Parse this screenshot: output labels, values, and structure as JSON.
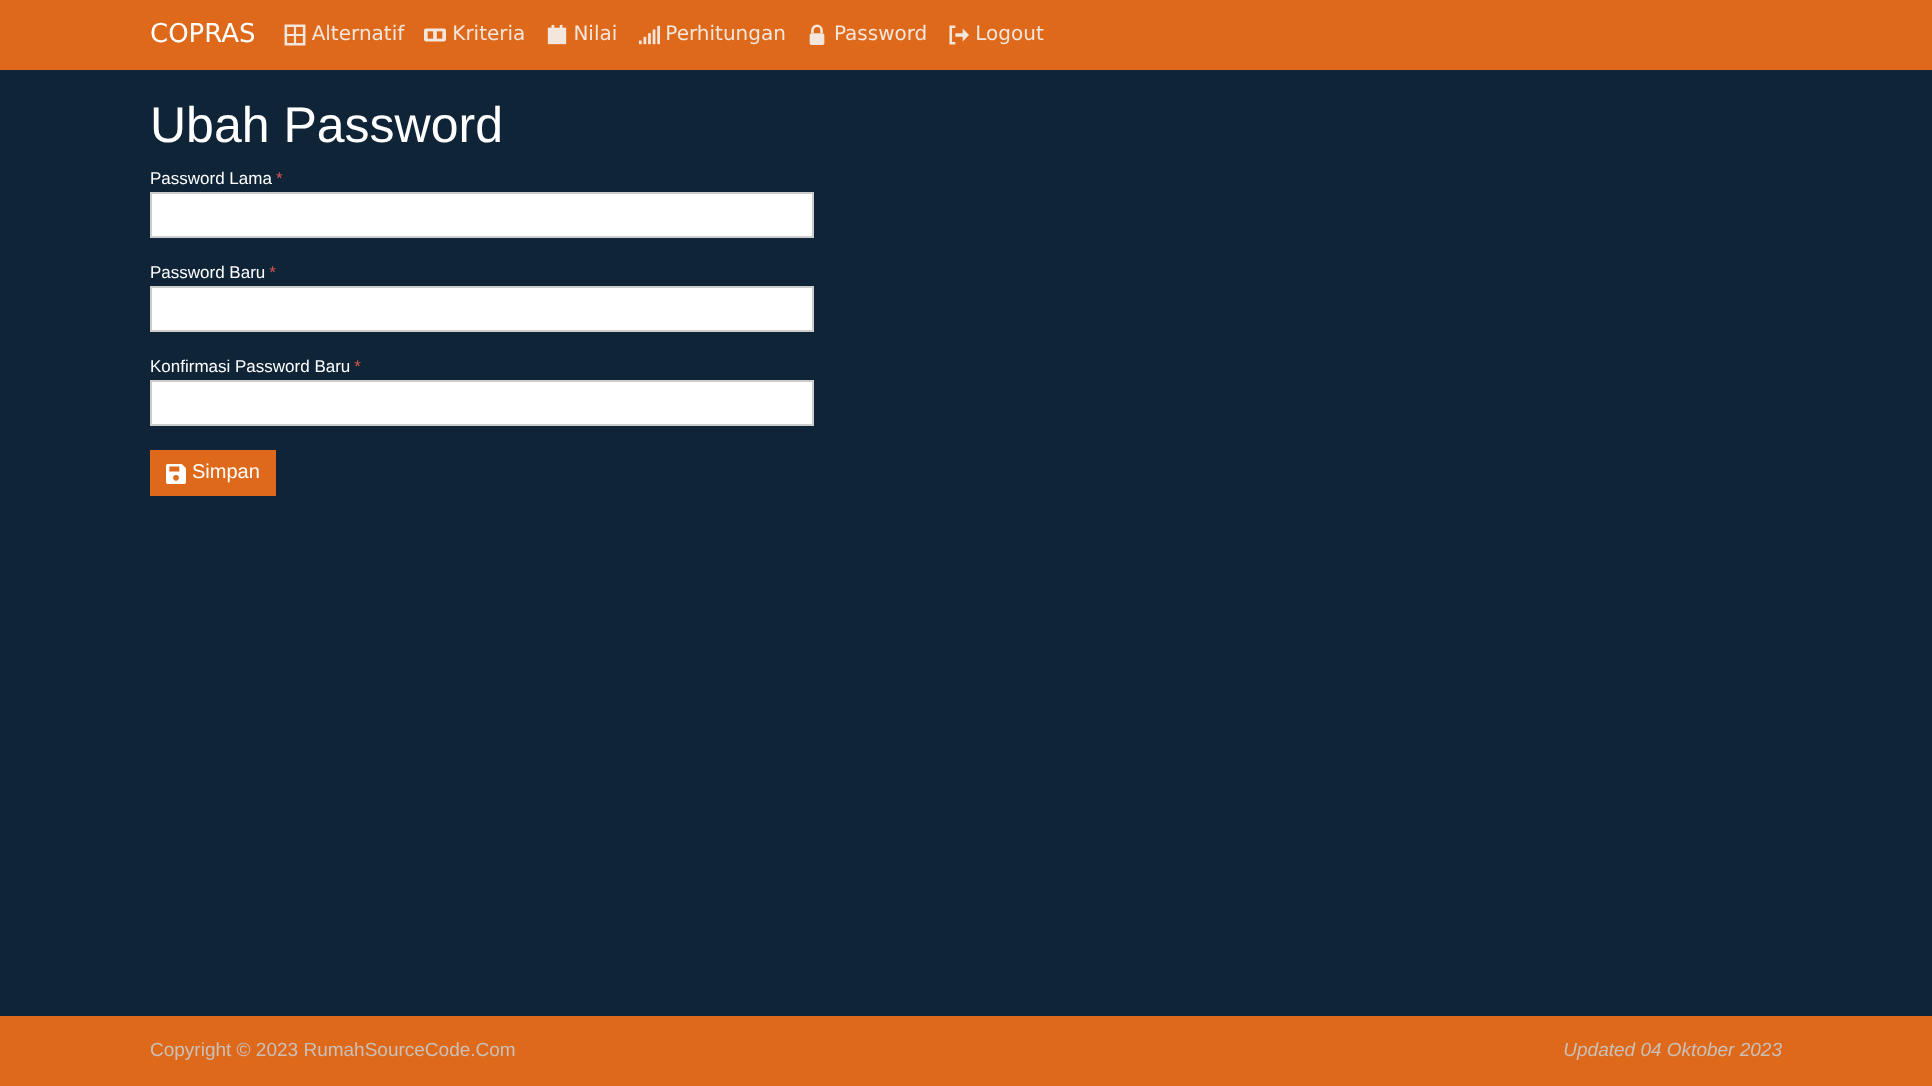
{
  "navbar": {
    "brand": "COPRAS",
    "items": [
      {
        "kind": "table",
        "label": "Alternatif"
      },
      {
        "kind": "card",
        "label": "Kriteria"
      },
      {
        "kind": "calendar",
        "label": "Nilai"
      },
      {
        "kind": "signal",
        "label": "Perhitungan"
      },
      {
        "kind": "lock",
        "label": "Password"
      },
      {
        "kind": "logout",
        "label": "Logout"
      }
    ]
  },
  "page": {
    "title": "Ubah Password",
    "fields": [
      {
        "label": "Password Lama",
        "required_mark": "*"
      },
      {
        "label": "Password Baru",
        "required_mark": "*"
      },
      {
        "label": "Konfirmasi Password Baru",
        "required_mark": "*"
      }
    ],
    "button": "Simpan"
  },
  "footer": {
    "copyright": "Copyright © 2023 RumahSourceCode.Com",
    "updated": "Updated 04 Oktober 2023"
  }
}
